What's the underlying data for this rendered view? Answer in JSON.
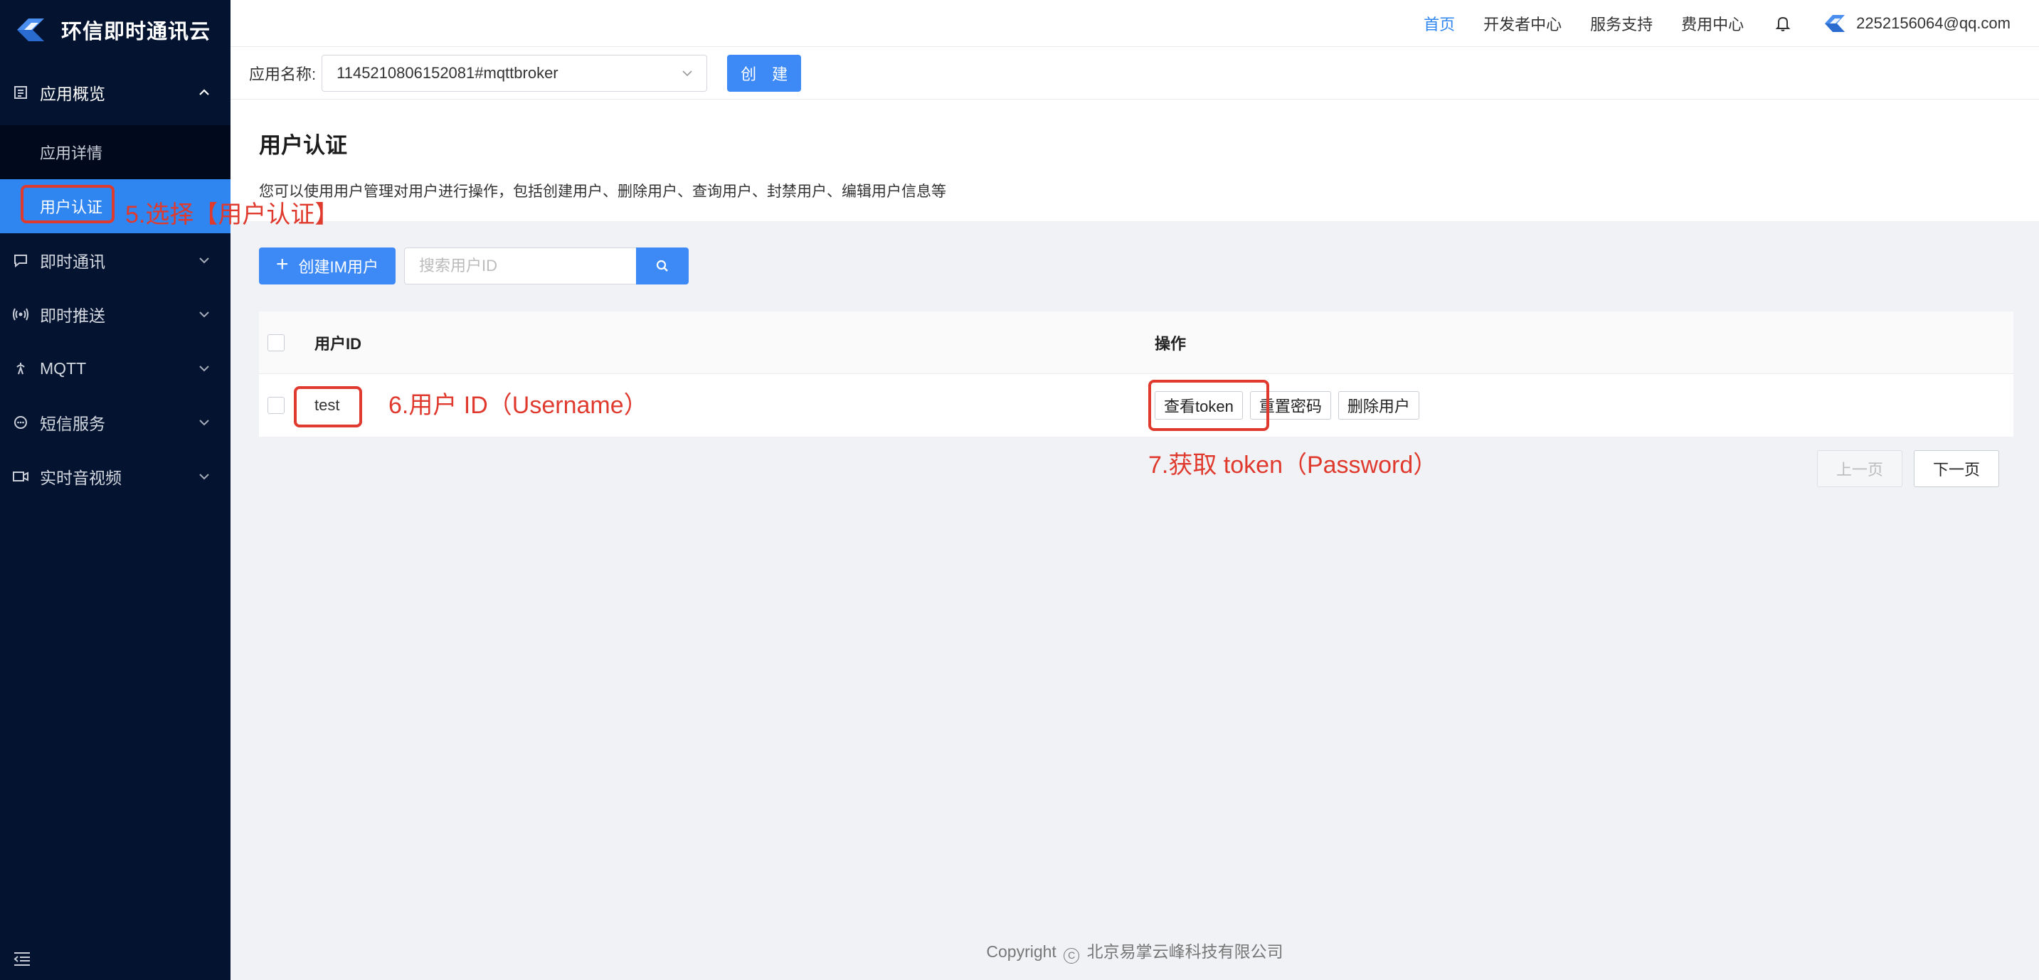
{
  "brand": {
    "name": "环信即时通讯云"
  },
  "sidebar": {
    "groups": [
      {
        "label": "应用概览",
        "open": true,
        "items": [
          {
            "label": "应用详情"
          },
          {
            "label": "用户认证",
            "active": true
          }
        ]
      },
      {
        "label": "即时通讯"
      },
      {
        "label": "即时推送"
      },
      {
        "label": "MQTT"
      },
      {
        "label": "短信服务"
      },
      {
        "label": "实时音视频"
      }
    ]
  },
  "topnav": {
    "items": [
      "首页",
      "开发者中心",
      "服务支持",
      "费用中心"
    ],
    "active": "首页",
    "user_email": "2252156064@qq.com"
  },
  "appbar": {
    "label": "应用名称:",
    "selected_app": "1145210806152081#mqttbroker",
    "create_label": "创 建"
  },
  "page": {
    "title": "用户认证",
    "description": "您可以使用用户管理对用户进行操作，包括创建用户、删除用户、查询用户、封禁用户、编辑用户信息等"
  },
  "toolbar": {
    "create_user_label": "创建IM用户",
    "search_placeholder": "搜索用户ID"
  },
  "table": {
    "columns": [
      "用户ID",
      "操作"
    ],
    "rows": [
      {
        "user_id": "test",
        "actions": [
          "查看token",
          "重置密码",
          "删除用户"
        ]
      }
    ]
  },
  "pager": {
    "prev": "上一页",
    "next": "下一页"
  },
  "footer": {
    "prefix": "Copyright",
    "mark": "C",
    "company": "北京易掌云峰科技有限公司"
  },
  "annotations": {
    "step5": "5.选择【用户认证】",
    "step6": "6.用户 ID（Username）",
    "step7": "7.获取 token（Password）"
  },
  "colors": {
    "accent": "#2f86f0",
    "sidebar_bg": "#041430",
    "annotation": "#e03a2e"
  }
}
